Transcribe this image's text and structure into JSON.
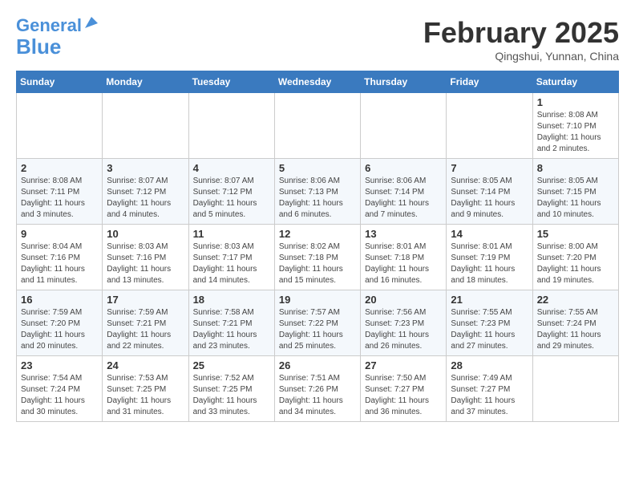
{
  "header": {
    "logo_line1": "General",
    "logo_line2": "Blue",
    "month": "February 2025",
    "location": "Qingshui, Yunnan, China"
  },
  "weekdays": [
    "Sunday",
    "Monday",
    "Tuesday",
    "Wednesday",
    "Thursday",
    "Friday",
    "Saturday"
  ],
  "weeks": [
    [
      {
        "day": "",
        "info": ""
      },
      {
        "day": "",
        "info": ""
      },
      {
        "day": "",
        "info": ""
      },
      {
        "day": "",
        "info": ""
      },
      {
        "day": "",
        "info": ""
      },
      {
        "day": "",
        "info": ""
      },
      {
        "day": "1",
        "info": "Sunrise: 8:08 AM\nSunset: 7:10 PM\nDaylight: 11 hours\nand 2 minutes."
      }
    ],
    [
      {
        "day": "2",
        "info": "Sunrise: 8:08 AM\nSunset: 7:11 PM\nDaylight: 11 hours\nand 3 minutes."
      },
      {
        "day": "3",
        "info": "Sunrise: 8:07 AM\nSunset: 7:12 PM\nDaylight: 11 hours\nand 4 minutes."
      },
      {
        "day": "4",
        "info": "Sunrise: 8:07 AM\nSunset: 7:12 PM\nDaylight: 11 hours\nand 5 minutes."
      },
      {
        "day": "5",
        "info": "Sunrise: 8:06 AM\nSunset: 7:13 PM\nDaylight: 11 hours\nand 6 minutes."
      },
      {
        "day": "6",
        "info": "Sunrise: 8:06 AM\nSunset: 7:14 PM\nDaylight: 11 hours\nand 7 minutes."
      },
      {
        "day": "7",
        "info": "Sunrise: 8:05 AM\nSunset: 7:14 PM\nDaylight: 11 hours\nand 9 minutes."
      },
      {
        "day": "8",
        "info": "Sunrise: 8:05 AM\nSunset: 7:15 PM\nDaylight: 11 hours\nand 10 minutes."
      }
    ],
    [
      {
        "day": "9",
        "info": "Sunrise: 8:04 AM\nSunset: 7:16 PM\nDaylight: 11 hours\nand 11 minutes."
      },
      {
        "day": "10",
        "info": "Sunrise: 8:03 AM\nSunset: 7:16 PM\nDaylight: 11 hours\nand 13 minutes."
      },
      {
        "day": "11",
        "info": "Sunrise: 8:03 AM\nSunset: 7:17 PM\nDaylight: 11 hours\nand 14 minutes."
      },
      {
        "day": "12",
        "info": "Sunrise: 8:02 AM\nSunset: 7:18 PM\nDaylight: 11 hours\nand 15 minutes."
      },
      {
        "day": "13",
        "info": "Sunrise: 8:01 AM\nSunset: 7:18 PM\nDaylight: 11 hours\nand 16 minutes."
      },
      {
        "day": "14",
        "info": "Sunrise: 8:01 AM\nSunset: 7:19 PM\nDaylight: 11 hours\nand 18 minutes."
      },
      {
        "day": "15",
        "info": "Sunrise: 8:00 AM\nSunset: 7:20 PM\nDaylight: 11 hours\nand 19 minutes."
      }
    ],
    [
      {
        "day": "16",
        "info": "Sunrise: 7:59 AM\nSunset: 7:20 PM\nDaylight: 11 hours\nand 20 minutes."
      },
      {
        "day": "17",
        "info": "Sunrise: 7:59 AM\nSunset: 7:21 PM\nDaylight: 11 hours\nand 22 minutes."
      },
      {
        "day": "18",
        "info": "Sunrise: 7:58 AM\nSunset: 7:21 PM\nDaylight: 11 hours\nand 23 minutes."
      },
      {
        "day": "19",
        "info": "Sunrise: 7:57 AM\nSunset: 7:22 PM\nDaylight: 11 hours\nand 25 minutes."
      },
      {
        "day": "20",
        "info": "Sunrise: 7:56 AM\nSunset: 7:23 PM\nDaylight: 11 hours\nand 26 minutes."
      },
      {
        "day": "21",
        "info": "Sunrise: 7:55 AM\nSunset: 7:23 PM\nDaylight: 11 hours\nand 27 minutes."
      },
      {
        "day": "22",
        "info": "Sunrise: 7:55 AM\nSunset: 7:24 PM\nDaylight: 11 hours\nand 29 minutes."
      }
    ],
    [
      {
        "day": "23",
        "info": "Sunrise: 7:54 AM\nSunset: 7:24 PM\nDaylight: 11 hours\nand 30 minutes."
      },
      {
        "day": "24",
        "info": "Sunrise: 7:53 AM\nSunset: 7:25 PM\nDaylight: 11 hours\nand 31 minutes."
      },
      {
        "day": "25",
        "info": "Sunrise: 7:52 AM\nSunset: 7:25 PM\nDaylight: 11 hours\nand 33 minutes."
      },
      {
        "day": "26",
        "info": "Sunrise: 7:51 AM\nSunset: 7:26 PM\nDaylight: 11 hours\nand 34 minutes."
      },
      {
        "day": "27",
        "info": "Sunrise: 7:50 AM\nSunset: 7:27 PM\nDaylight: 11 hours\nand 36 minutes."
      },
      {
        "day": "28",
        "info": "Sunrise: 7:49 AM\nSunset: 7:27 PM\nDaylight: 11 hours\nand 37 minutes."
      },
      {
        "day": "",
        "info": ""
      }
    ]
  ]
}
